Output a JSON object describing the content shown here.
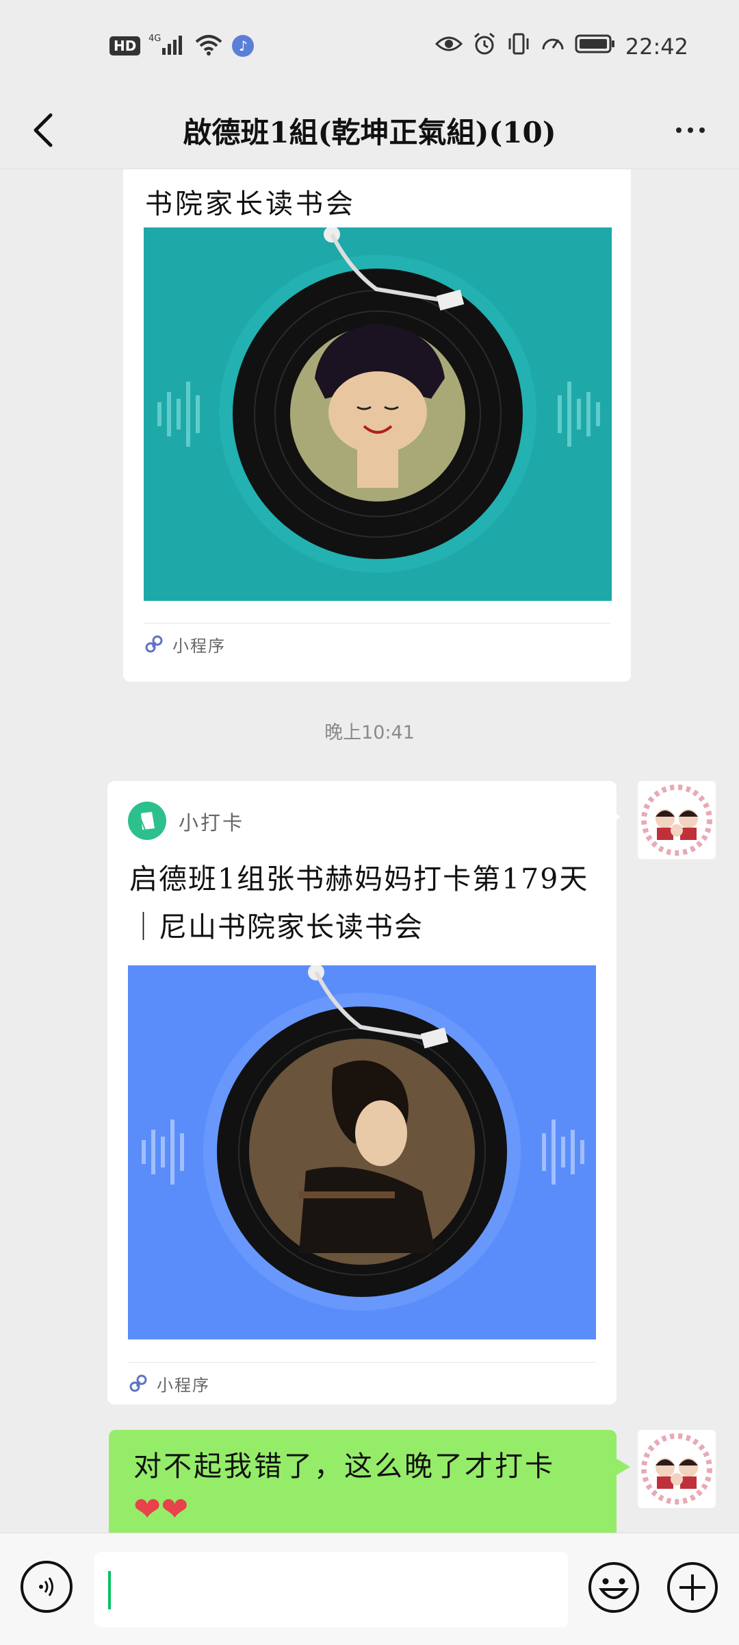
{
  "status_bar": {
    "hd": "HD",
    "network": "4G",
    "time": "22:42"
  },
  "header": {
    "title": "啟德班1組(乾坤正氣組)(10)",
    "back_icon": "chevron-left-icon",
    "more_icon": "more-dots-icon"
  },
  "messages": {
    "card1": {
      "title": "书院家长读书会",
      "footer_label": "小程序"
    },
    "timestamp": "晚上10:41",
    "card2": {
      "app_name": "小打卡",
      "title": "启德班1组张书赫妈妈打卡第179天｜尼山书院家长读书会",
      "footer_label": "小程序"
    },
    "text_message": {
      "text": "对不起我错了，这么晚了才打卡",
      "emoji": "❤❤"
    }
  },
  "input_bar": {
    "voice_icon": "voice-icon",
    "emoji_icon": "emoji-icon",
    "plus_icon": "plus-icon"
  },
  "colors": {
    "card1_bg": "#1fa8a8",
    "card2_bg": "#5a8dfa",
    "bubble_green": "#95ec69",
    "app_green": "#2dc08d"
  }
}
